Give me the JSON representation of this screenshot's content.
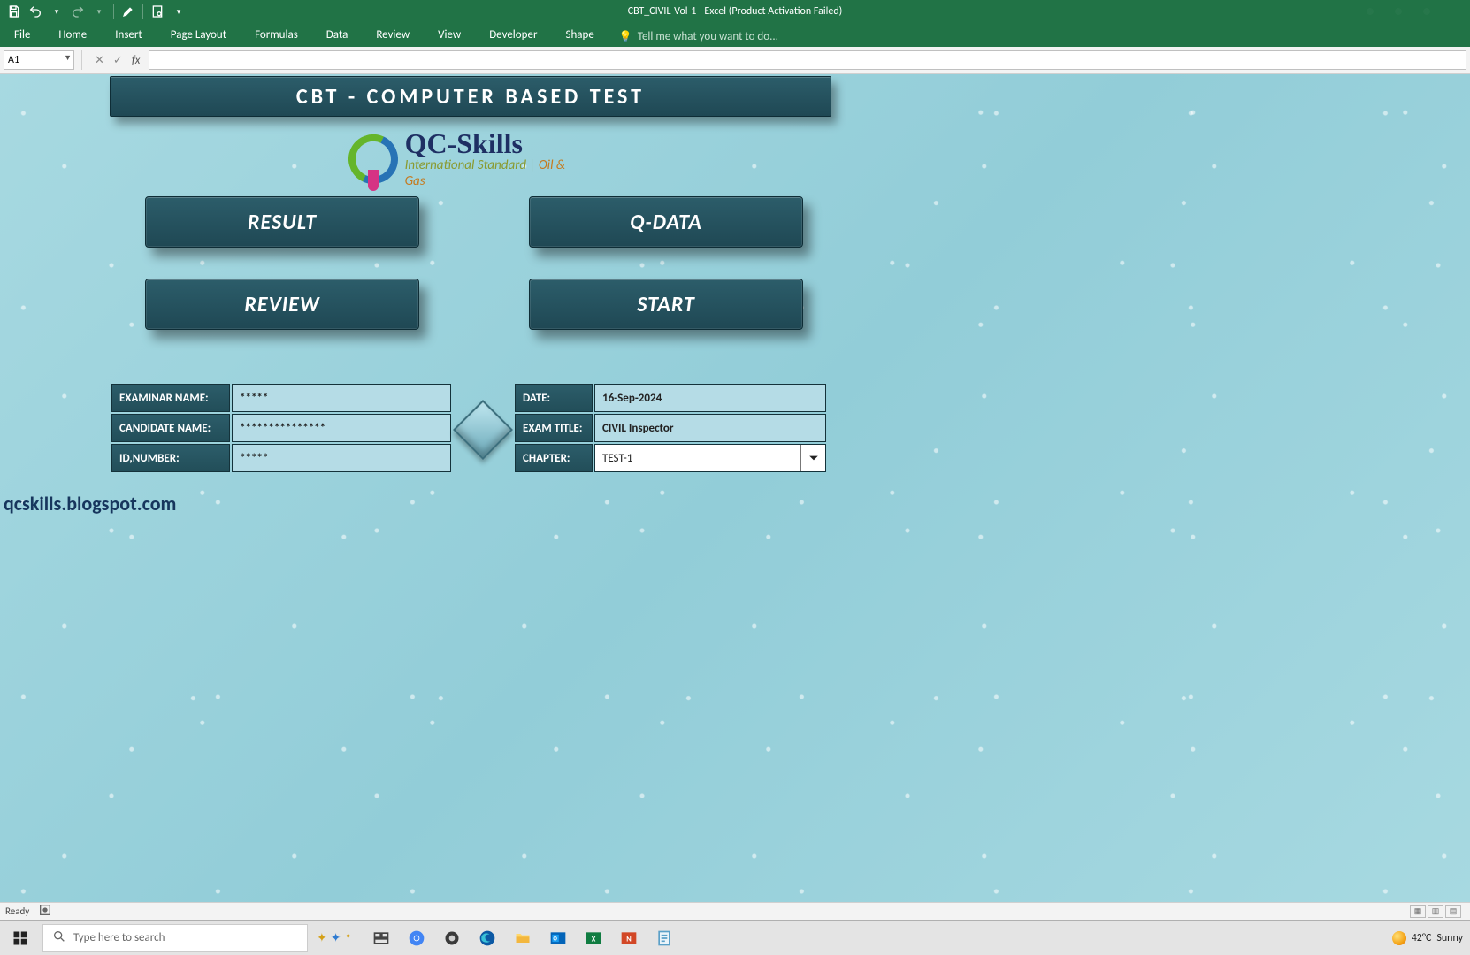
{
  "app": {
    "title": "CBT_CIVIL-Vol-1 - Excel (Product Activation Failed)"
  },
  "qat": {
    "save": "save-icon",
    "undo": "undo-icon",
    "redo": "redo-icon",
    "touch": "touch-mode-icon",
    "preview": "print-preview-icon"
  },
  "ribbon": {
    "tabs": [
      "File",
      "Home",
      "Insert",
      "Page Layout",
      "Formulas",
      "Data",
      "Review",
      "View",
      "Developer",
      "Shape"
    ],
    "tell_me": "Tell me what you want to do..."
  },
  "formula_bar": {
    "name_box": "A1",
    "cancel": "cancel-icon",
    "enter": "enter-icon",
    "fx": "fx",
    "formula": ""
  },
  "sheet": {
    "title": "CBT - COMPUTER BASED TEST",
    "logo": {
      "line1": "QC-Skills",
      "line2a": "International Standard",
      "line2sep": " | ",
      "line2b": "Oil & Gas"
    },
    "buttons": {
      "result": "RESULT",
      "qdata": "Q-DATA",
      "review": "REVIEW",
      "start": "START"
    },
    "left_table": [
      {
        "label": "EXAMINAR NAME:",
        "value": "*****"
      },
      {
        "label": "CANDIDATE NAME:",
        "value": "***************"
      },
      {
        "label": "ID,NUMBER:",
        "value": "*****"
      }
    ],
    "right_table": {
      "date_label": "DATE:",
      "date_value": "16-Sep-2024",
      "exam_title_label": "EXAM TITLE:",
      "exam_title_value": "CIVIL Inspector",
      "chapter_label": "CHAPTER:",
      "chapter_value": "TEST-1"
    },
    "blog": "qcskills.blogspot.com"
  },
  "status": {
    "ready": "Ready",
    "macro": "macro-recorder-icon"
  },
  "taskbar": {
    "search_placeholder": "Type here to search",
    "weather_temp": "42°C",
    "weather_desc": "Sunny"
  }
}
